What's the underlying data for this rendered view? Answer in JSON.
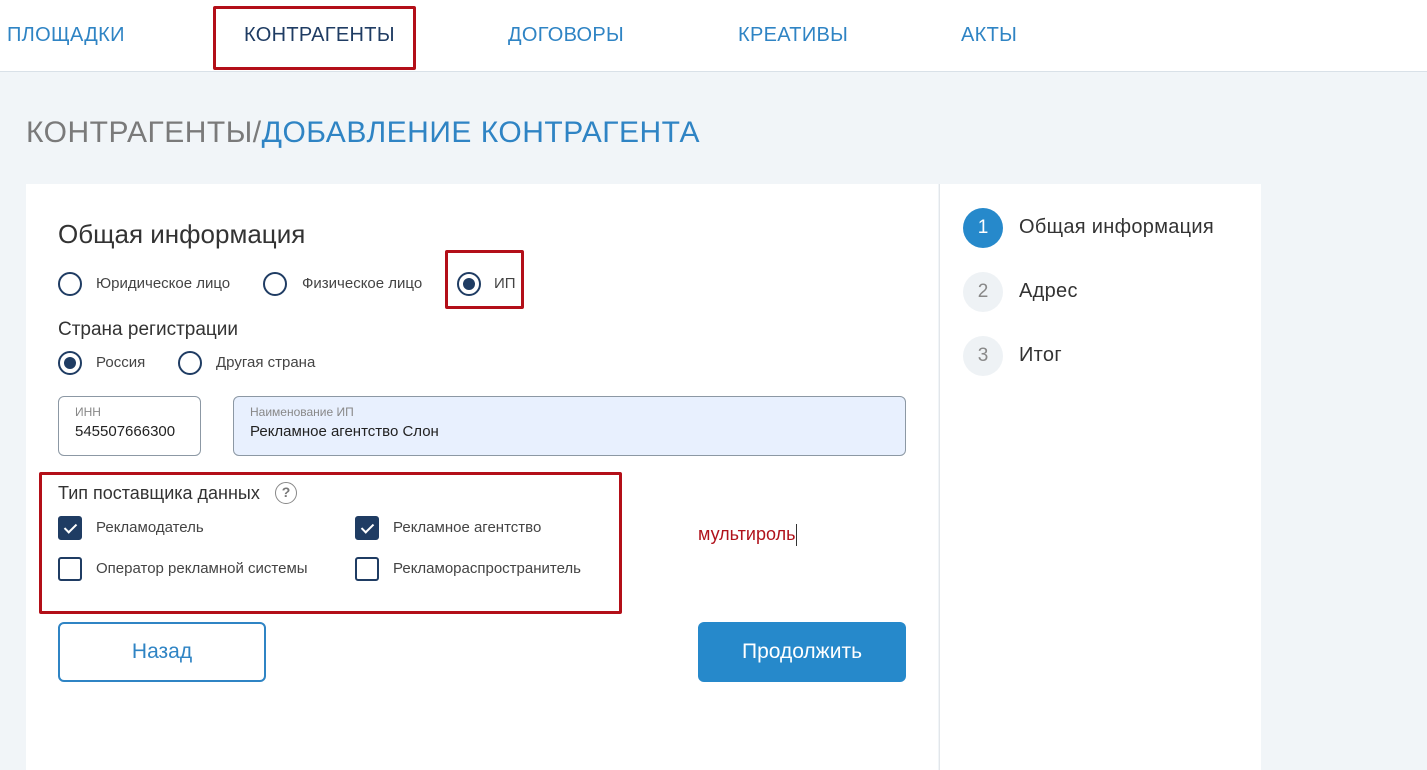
{
  "nav": {
    "items": [
      {
        "label": "ПЛОЩАДКИ"
      },
      {
        "label": "КОНТРАГЕНТЫ"
      },
      {
        "label": "ДОГОВОРЫ"
      },
      {
        "label": "КРЕАТИВЫ"
      },
      {
        "label": "АКТЫ"
      }
    ],
    "active": "КОНТРАГЕНТЫ"
  },
  "breadcrumb": {
    "root": "КОНТРАГЕНТЫ",
    "separator": "/",
    "current": "ДОБАВЛЕНИЕ КОНТРАГЕНТА"
  },
  "form": {
    "section_title": "Общая информация",
    "entity_type": {
      "options": [
        "Юридическое лицо",
        "Физическое лицо",
        "ИП"
      ],
      "selected": "ИП"
    },
    "country": {
      "label": "Страна регистрации",
      "options": [
        "Россия",
        "Другая страна"
      ],
      "selected": "Россия"
    },
    "inn": {
      "label": "ИНН",
      "value": "545507666300"
    },
    "name": {
      "label": "Наименование ИП",
      "value": "Рекламное агентство Слон"
    },
    "supplier": {
      "label": "Тип поставщика данных",
      "options": [
        {
          "label": "Рекламодатель",
          "checked": true
        },
        {
          "label": "Рекламное агентство",
          "checked": true
        },
        {
          "label": "Оператор рекламной системы",
          "checked": false
        },
        {
          "label": "Рекламораспространитель",
          "checked": false
        }
      ]
    },
    "annotation": "мультироль",
    "back_label": "Назад",
    "next_label": "Продолжить"
  },
  "steps": [
    {
      "number": "1",
      "label": "Общая информация",
      "active": true
    },
    {
      "number": "2",
      "label": "Адрес",
      "active": false
    },
    {
      "number": "3",
      "label": "Итог",
      "active": false
    }
  ],
  "colors": {
    "accent": "#2689cb",
    "dark_blue": "#1f3c63",
    "highlight_red": "#b30f18"
  }
}
